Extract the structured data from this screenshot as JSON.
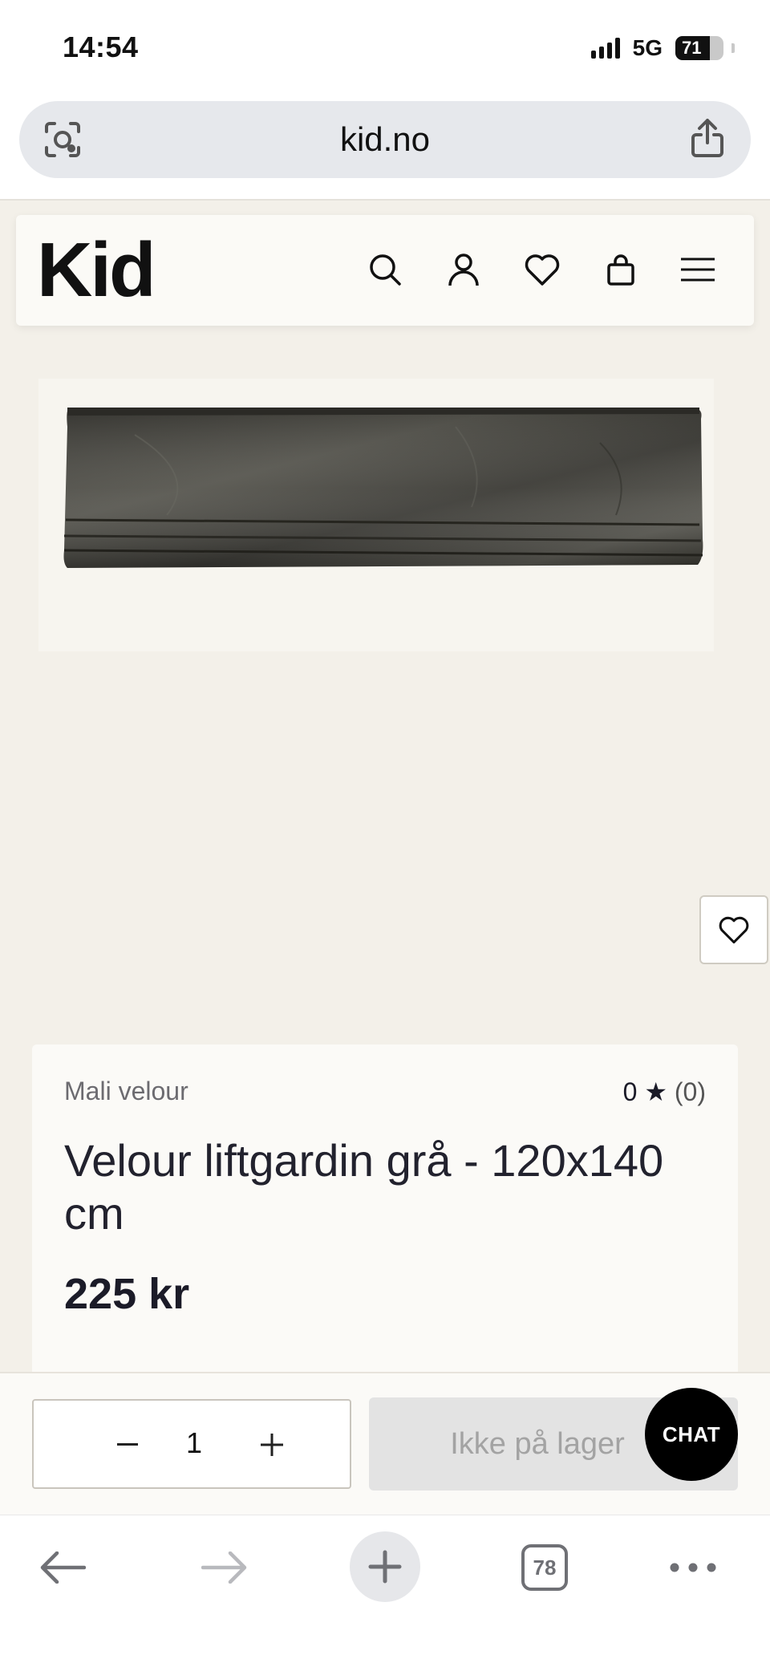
{
  "status": {
    "time": "14:54",
    "network": "5G",
    "battery": "71",
    "battery_level": 0.71
  },
  "browser": {
    "url": "kid.no",
    "tab_count": "78"
  },
  "header": {
    "logo": "Kid",
    "icons": [
      "search-icon",
      "account-icon",
      "heart-icon",
      "bag-icon",
      "menu-icon"
    ]
  },
  "product": {
    "brand": "Mali velour",
    "rating": "0 ★",
    "rating_count": "(0)",
    "title": "Velour liftgardin grå - 120x140 cm",
    "price": "225 kr"
  },
  "purchase": {
    "quantity": "1",
    "stock_label": "Ikke på lager",
    "chat_label": "CHAT"
  },
  "colors": {
    "page_bg": "#f3f0e9",
    "card_bg": "#fbfaf7",
    "chat_bg": "#000000"
  }
}
